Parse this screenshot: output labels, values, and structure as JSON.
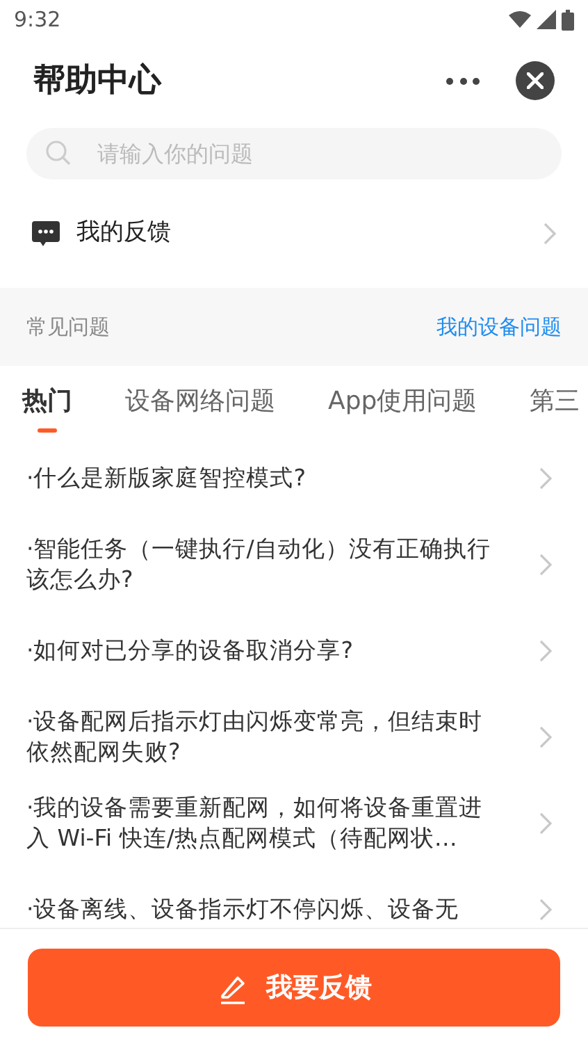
{
  "status_bar": {
    "time": "9:32"
  },
  "header": {
    "title": "帮助中心"
  },
  "search": {
    "placeholder": "请输入你的问题"
  },
  "feedback_link": {
    "label": "我的反馈"
  },
  "section": {
    "title": "常见问题",
    "link": "我的设备问题"
  },
  "tabs": [
    {
      "label": "热门",
      "selected": true
    },
    {
      "label": "设备网络问题",
      "selected": false
    },
    {
      "label": "App使用问题",
      "selected": false
    },
    {
      "label": "第三",
      "selected": false
    }
  ],
  "questions": [
    "·什么是新版家庭智控模式?",
    "·智能任务（一键执行/自动化）没有正确执行该怎么办?",
    "·如何对已分享的设备取消分享?",
    "·设备配网后指示灯由闪烁变常亮，但结束时依然配网失败?",
    "·我的设备需要重新配网，如何将设备重置进入 Wi-Fi 快连/热点配网模式（待配网状…",
    "·设备离线、设备指示灯不停闪烁、设备无"
  ],
  "submit_button": {
    "label": "我要反馈"
  }
}
